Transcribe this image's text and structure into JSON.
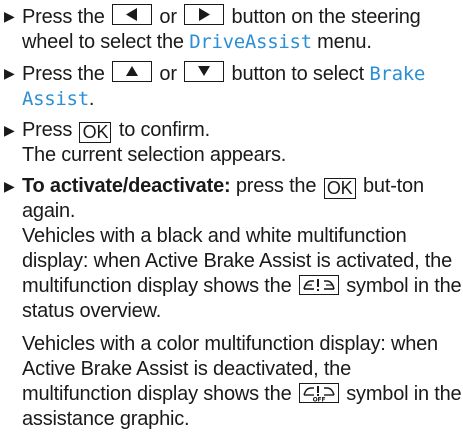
{
  "steps": [
    {
      "pre": "Press the",
      "mid": "or",
      "post": "button on the steering wheel to select the",
      "menu": "DriveAssist",
      "end": "menu."
    },
    {
      "pre": "Press the",
      "mid": "or",
      "post": "button to select",
      "item": "Brake Assist",
      "end": "."
    },
    {
      "pre": "Press",
      "ok": "OK",
      "post": "to confirm.",
      "line2": "The current selection appears."
    },
    {
      "bold": "To activate/deactivate:",
      "pre": "press the",
      "ok": "OK",
      "post": "but-ton again.",
      "para1_pre": "Vehicles with a black and white multifunction display: when Active Brake Assist is activated, the multifunction display shows the",
      "para1_post": "symbol in the status overview.",
      "para2_pre": "Vehicles with a color multifunction display: when Active Brake Assist is deactivated, the multifunction display shows the",
      "para2_post": "symbol in the assistance graphic."
    }
  ],
  "icons": {
    "bullet": "triangle-right-bullet",
    "left": "left-arrow-button-icon",
    "right": "right-arrow-button-icon",
    "up": "up-arrow-button-icon",
    "down": "down-arrow-button-icon",
    "symbol1": "brake-assist-symbol-icon",
    "symbol2": "brake-assist-off-symbol-icon"
  },
  "colors": {
    "text": "#1a1a1a",
    "menu_highlight": "#2b8fd6"
  }
}
